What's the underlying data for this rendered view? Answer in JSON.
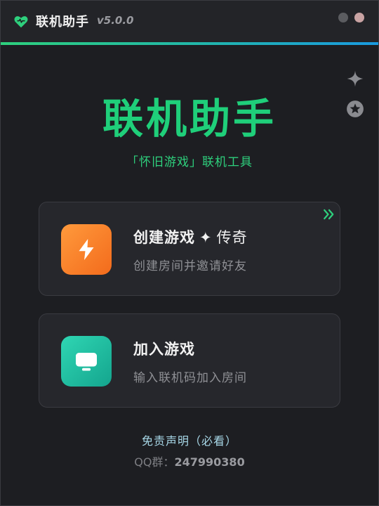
{
  "titlebar": {
    "app_name": "联机助手",
    "version": "v5.0.0",
    "logo_icon": "heart-icon",
    "buttons": [
      "minimize-button",
      "close-button"
    ]
  },
  "side_icons": [
    "sparkle-icon",
    "star-badge-icon"
  ],
  "hero": {
    "title": "联机助手",
    "subtitle": "「怀旧游戏」联机工具"
  },
  "cards": {
    "create": {
      "title": "创建游戏",
      "separator": "✦",
      "title_extra": "传奇",
      "description": "创建房间并邀请好友",
      "icon": "lightning-icon"
    },
    "join": {
      "title": "加入游戏",
      "description": "输入联机码加入房间",
      "icon": "monitor-icon"
    }
  },
  "footer": {
    "disclaimer": "免责声明（必看）",
    "qq_label": "QQ群：",
    "qq_number": "247990380"
  },
  "colors": {
    "accent_green": "#1fcf7a",
    "orange": "#f36b1c",
    "teal": "#14a58e",
    "background": "#1d1e22",
    "card": "#26272c"
  }
}
